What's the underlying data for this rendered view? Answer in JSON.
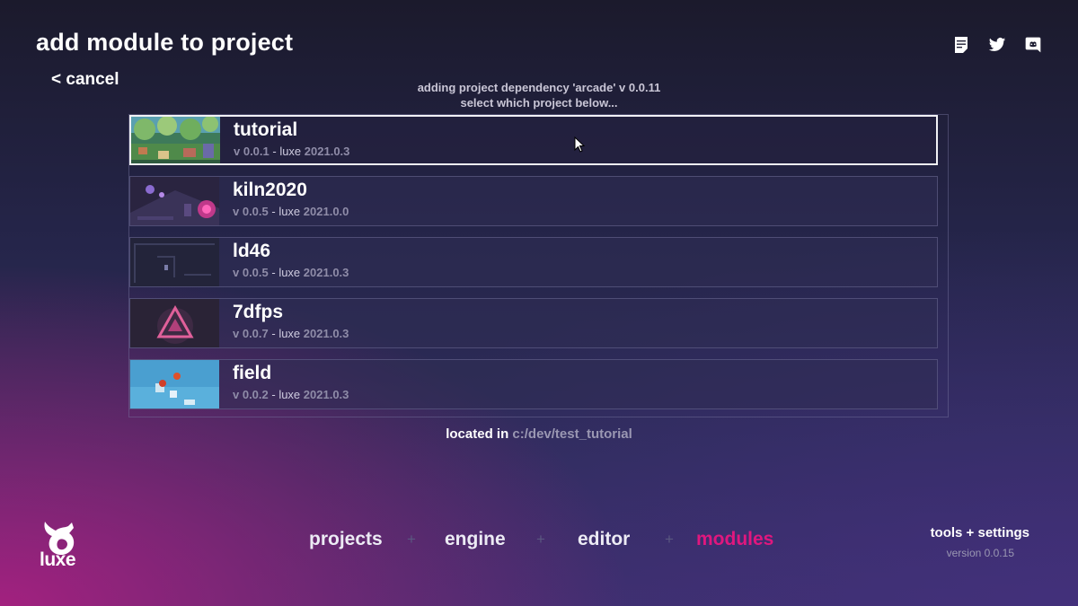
{
  "header": {
    "title": "add module to project",
    "cancel_label": "< cancel",
    "icons": [
      "notes-icon",
      "twitter-icon",
      "discord-icon"
    ]
  },
  "prompt": {
    "line1": "adding project dependency 'arcade' v 0.0.11",
    "line2": "select which project below..."
  },
  "projects": [
    {
      "name": "tutorial",
      "version": "v 0.0.1",
      "sep": " - luxe ",
      "engine": "2021.0.3",
      "selected": true
    },
    {
      "name": "kiln2020",
      "version": "v 0.0.5",
      "sep": " - luxe ",
      "engine": "2021.0.0",
      "selected": false
    },
    {
      "name": "ld46",
      "version": "v 0.0.5",
      "sep": " - luxe ",
      "engine": "2021.0.3",
      "selected": false
    },
    {
      "name": "7dfps",
      "version": "v 0.0.7",
      "sep": " - luxe ",
      "engine": "2021.0.3",
      "selected": false
    },
    {
      "name": "field",
      "version": "v 0.0.2",
      "sep": " - luxe ",
      "engine": "2021.0.3",
      "selected": false
    }
  ],
  "location": {
    "label": "located in",
    "path": "c:/dev/test_tutorial"
  },
  "nav": {
    "items": [
      "projects",
      "engine",
      "editor",
      "modules"
    ],
    "separator": "+",
    "active": "modules"
  },
  "footer": {
    "logo_text": "luxe",
    "tools_label": "tools + settings",
    "version": "version 0.0.15"
  },
  "colors": {
    "accent": "#e0177e",
    "muted": "#8f8ca8"
  }
}
